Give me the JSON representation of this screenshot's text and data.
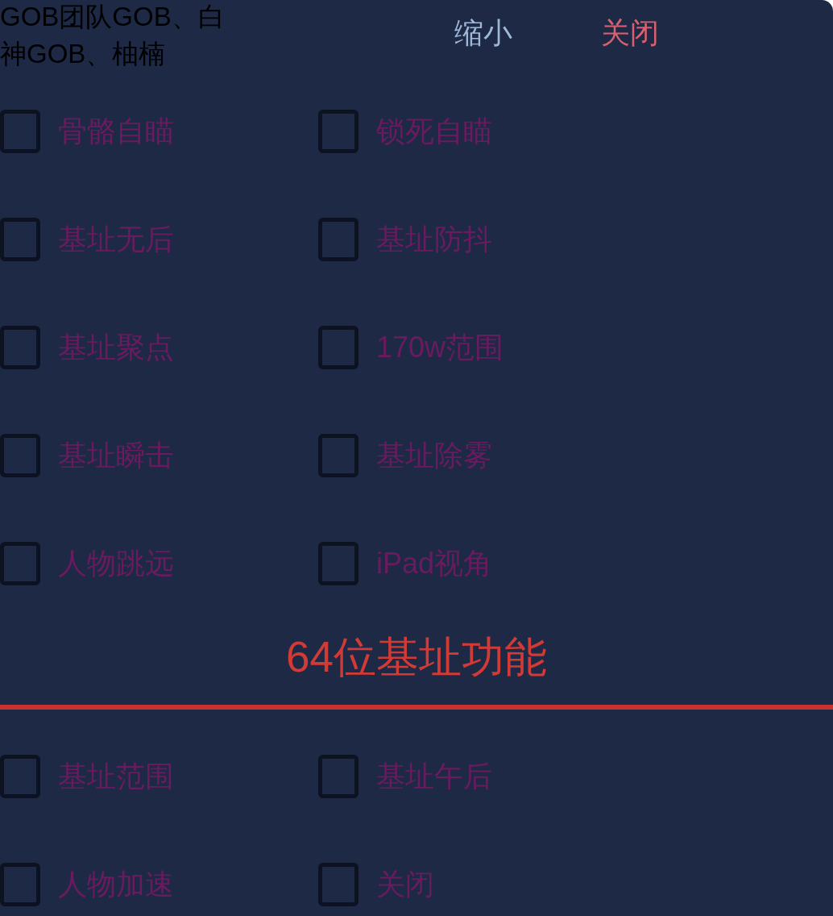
{
  "header": {
    "credits": "GOB团队GOB、白神GOB、柚楠",
    "buttons": [
      {
        "label": "缩小",
        "kind": "minimize"
      },
      {
        "label": "关闭",
        "kind": "close"
      }
    ]
  },
  "options": [
    {
      "label": "骨骼自瞄",
      "checked": false
    },
    {
      "label": "锁死自瞄",
      "checked": false
    },
    {
      "label": "基址无后",
      "checked": false
    },
    {
      "label": "基址防抖",
      "checked": false
    },
    {
      "label": "基址聚点",
      "checked": false
    },
    {
      "label": "170w范围",
      "checked": false
    },
    {
      "label": "基址瞬击",
      "checked": false
    },
    {
      "label": "基址除雾",
      "checked": false
    },
    {
      "label": "人物跳远",
      "checked": false
    },
    {
      "label": "iPad视角",
      "checked": false
    }
  ],
  "section": {
    "title": "64位基址功能",
    "options": [
      {
        "label": "基址范围",
        "checked": false
      },
      {
        "label": "基址午后",
        "checked": false
      },
      {
        "label": "人物加速",
        "checked": false
      },
      {
        "label": "关闭",
        "checked": false
      }
    ]
  }
}
